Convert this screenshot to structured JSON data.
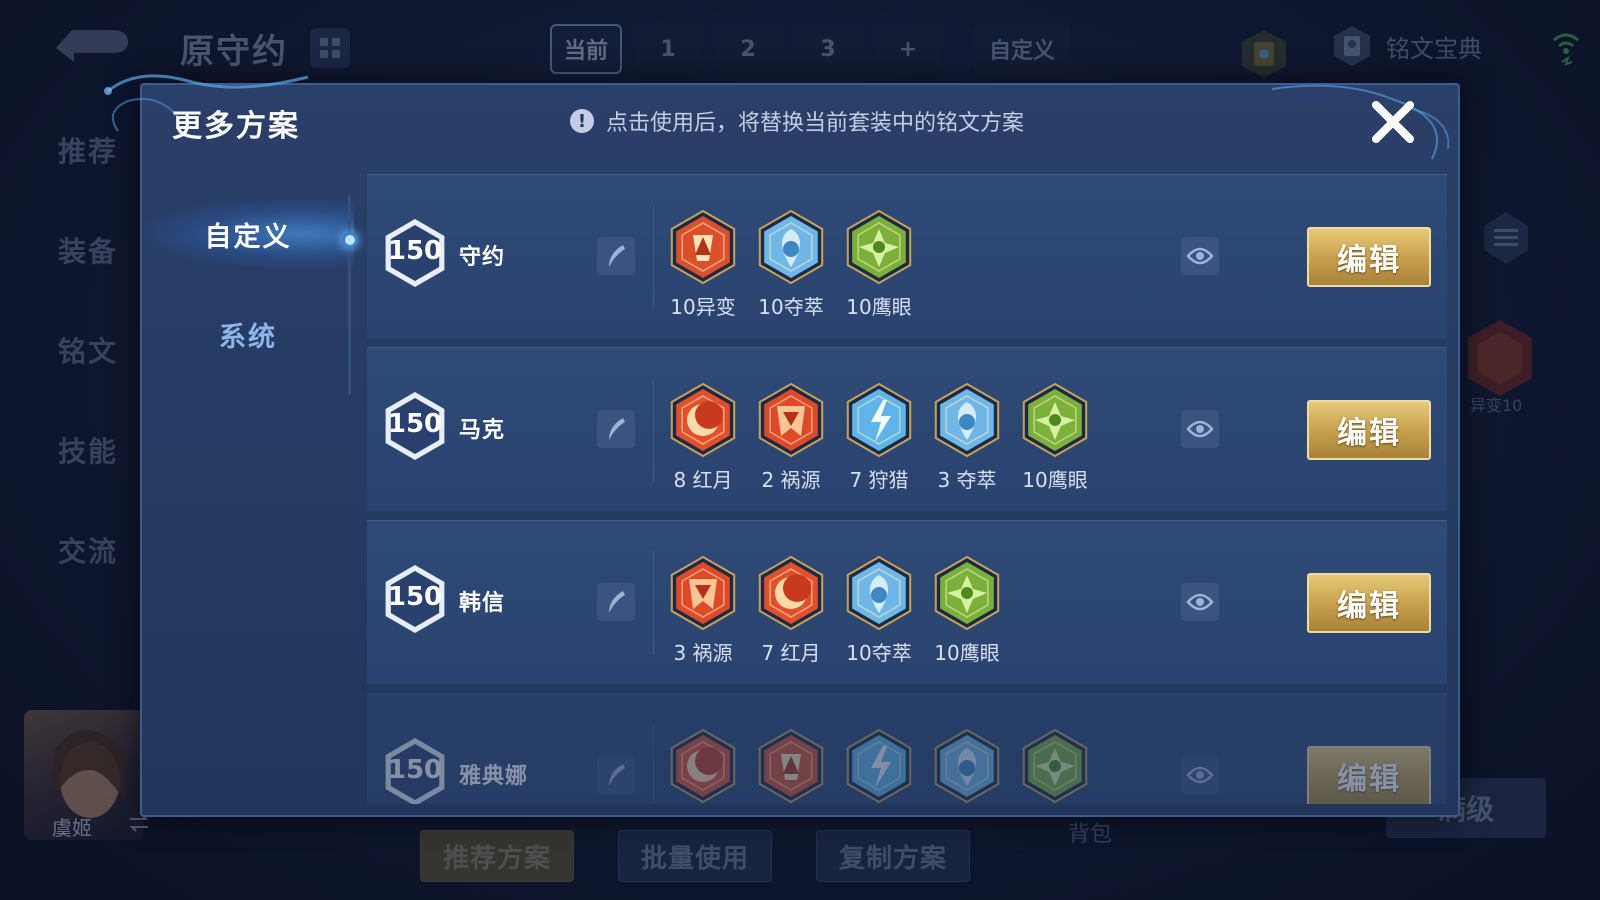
{
  "topbar": {
    "title": "原守约",
    "tabs": [
      {
        "label": "当前",
        "active": true
      },
      {
        "label": "1",
        "active": false
      },
      {
        "label": "2",
        "active": false
      },
      {
        "label": "3",
        "active": false
      },
      {
        "label": "+",
        "active": false
      }
    ],
    "custom_tab": "自定义",
    "book_label": "铭文宝典"
  },
  "side_nav": [
    "推荐",
    "装备",
    "铭文",
    "技能",
    "交流"
  ],
  "hero": {
    "name": "虞姬"
  },
  "bottom_buttons": [
    "推荐方案",
    "批量使用",
    "复制方案"
  ],
  "bag_label": "背包",
  "max_label": "满级",
  "right_rune_label": "异变10",
  "modal": {
    "title": "更多方案",
    "notice": "点击使用后，将替换当前套装中的铭文方案",
    "notice_icon": "!",
    "sidebar": [
      {
        "label": "自定义",
        "active": true
      },
      {
        "label": "系统",
        "active": false
      }
    ],
    "edit_label": "编辑",
    "schemes": [
      {
        "level": "150",
        "name": "守约",
        "runes": [
          {
            "label": "10异变",
            "type": "yibian",
            "color": "#d9502a"
          },
          {
            "label": "10夺萃",
            "type": "duocui",
            "color": "#6fb7e6"
          },
          {
            "label": "10鹰眼",
            "type": "yingyan",
            "color": "#7bb13a"
          }
        ]
      },
      {
        "level": "150",
        "name": "马克",
        "runes": [
          {
            "label": "8 红月",
            "type": "hongyue",
            "color": "#e0512b"
          },
          {
            "label": "2 祸源",
            "type": "huoyuan",
            "color": "#de4a28"
          },
          {
            "label": "7 狩猎",
            "type": "shoulie",
            "color": "#5fb5e8"
          },
          {
            "label": "3 夺萃",
            "type": "duocui",
            "color": "#6fb7e6"
          },
          {
            "label": "10鹰眼",
            "type": "yingyan",
            "color": "#7bb13a"
          }
        ]
      },
      {
        "level": "150",
        "name": "韩信",
        "runes": [
          {
            "label": "3 祸源",
            "type": "huoyuan",
            "color": "#de4a28"
          },
          {
            "label": "7 红月",
            "type": "hongyue",
            "color": "#e0512b"
          },
          {
            "label": "10夺萃",
            "type": "duocui",
            "color": "#6fb7e6"
          },
          {
            "label": "10鹰眼",
            "type": "yingyan",
            "color": "#7bb13a"
          }
        ]
      },
      {
        "level": "150",
        "name": "雅典娜",
        "runes": [
          {
            "label": "",
            "type": "hongyue",
            "color": "#e0512b"
          },
          {
            "label": "",
            "type": "yibian",
            "color": "#d9502a"
          },
          {
            "label": "",
            "type": "shoulie",
            "color": "#5fb5e8"
          },
          {
            "label": "",
            "type": "duocui",
            "color": "#6fb7e6"
          },
          {
            "label": "",
            "type": "yingyan",
            "color": "#7bb13a"
          }
        ]
      }
    ]
  }
}
